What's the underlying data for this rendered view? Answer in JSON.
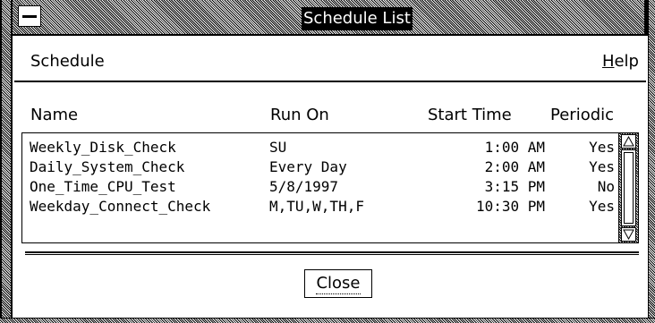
{
  "window": {
    "title": "Schedule List"
  },
  "menu": {
    "schedule": "Schedule",
    "help_mnemonic": "H",
    "help_rest": "elp"
  },
  "columns": {
    "name": "Name",
    "run_on": "Run On",
    "start_time": "Start Time",
    "periodic": "Periodic"
  },
  "rows": [
    {
      "name": "Weekly_Disk_Check",
      "run_on": "SU",
      "start_time": "1:00 AM",
      "periodic": "Yes"
    },
    {
      "name": "Daily_System_Check",
      "run_on": "Every Day",
      "start_time": "2:00 AM",
      "periodic": "Yes"
    },
    {
      "name": "One_Time_CPU_Test",
      "run_on": "5/8/1997",
      "start_time": "3:15 PM",
      "periodic": "No"
    },
    {
      "name": "Weekday_Connect_Check",
      "run_on": "M,TU,W,TH,F",
      "start_time": "10:30 PM",
      "periodic": "Yes"
    }
  ],
  "buttons": {
    "close": "Close"
  },
  "icons": {
    "window_menu": "window-menu-icon",
    "scroll_up": "scroll-up-arrow-icon",
    "scroll_down": "scroll-down-arrow-icon"
  }
}
